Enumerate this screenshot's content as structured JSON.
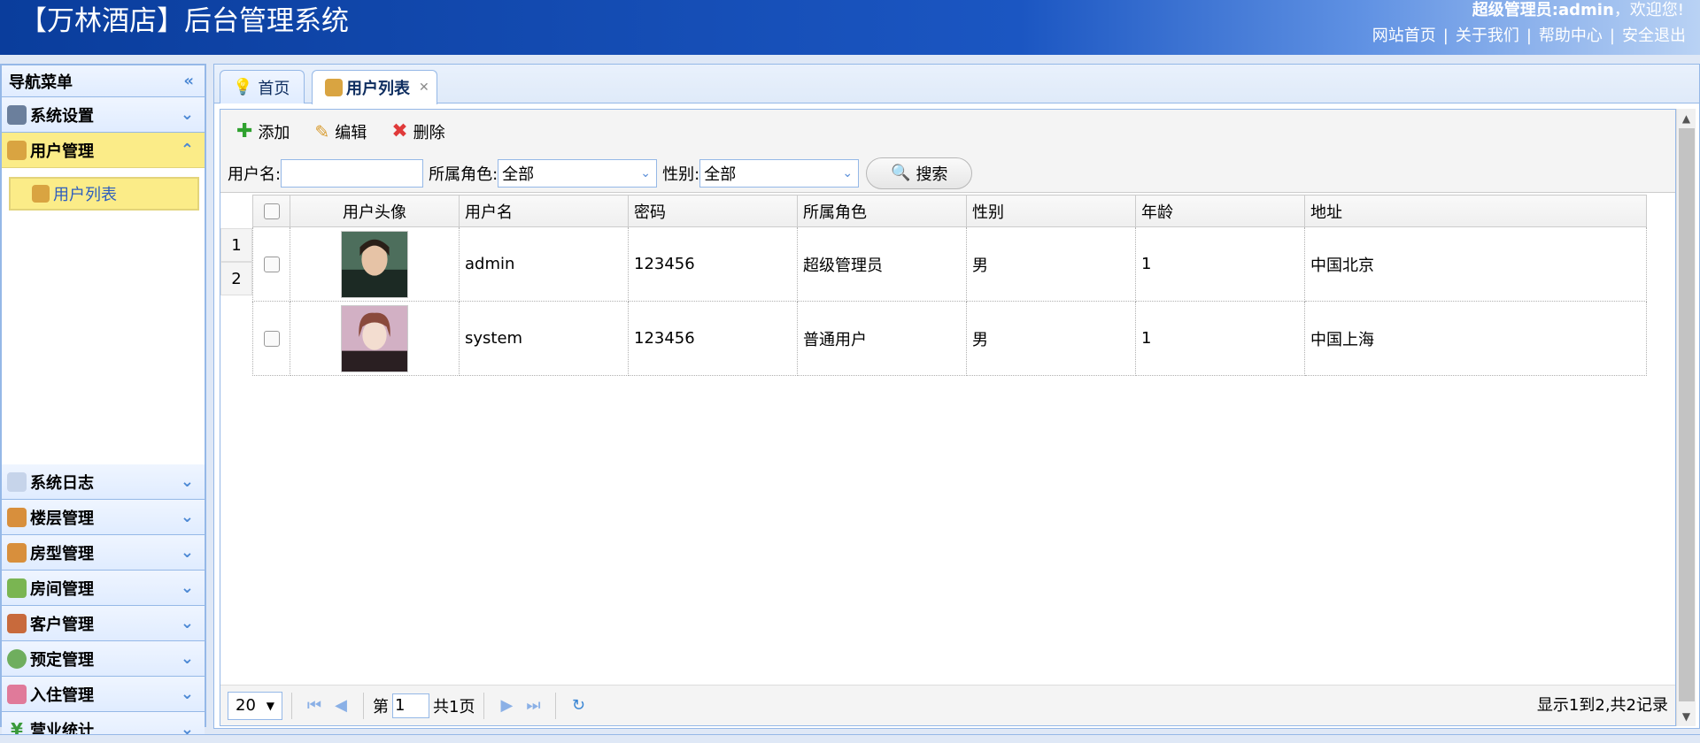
{
  "header": {
    "title": "【万林酒店】后台管理系统",
    "welcome_user": "超级管理员:admin",
    "welcome_suffix": "，欢迎您!",
    "links": [
      "网站首页",
      "关于我们",
      "帮助中心",
      "安全退出"
    ]
  },
  "nav": {
    "title": "导航菜单",
    "groups": [
      {
        "label": "系统设置"
      },
      {
        "label": "用户管理"
      },
      {
        "label": "系统日志"
      },
      {
        "label": "楼层管理"
      },
      {
        "label": "房型管理"
      },
      {
        "label": "房间管理"
      },
      {
        "label": "客户管理"
      },
      {
        "label": "预定管理"
      },
      {
        "label": "入住管理"
      },
      {
        "label": "营业统计"
      }
    ],
    "sub_item": "用户列表"
  },
  "tabs": [
    {
      "label": "首页"
    },
    {
      "label": "用户列表"
    }
  ],
  "toolbar": {
    "add": "添加",
    "edit": "编辑",
    "delete": "删除"
  },
  "filters": {
    "username_label": "用户名:",
    "username_value": "",
    "role_label": "所属角色:",
    "role_value": "全部",
    "gender_label": "性别:",
    "gender_value": "全部",
    "search": "搜索"
  },
  "table": {
    "headers": [
      "用户头像",
      "用户名",
      "密码",
      "所属角色",
      "性别",
      "年龄",
      "地址"
    ],
    "row_numbers": [
      "1",
      "2"
    ],
    "rows": [
      [
        "admin",
        "123456",
        "超级管理员",
        "男",
        "1",
        "中国北京"
      ],
      [
        "system",
        "123456",
        "普通用户",
        "男",
        "1",
        "中国上海"
      ]
    ]
  },
  "pager": {
    "page_size": "20",
    "page_prefix": "第",
    "page_value": "1",
    "page_suffix": "共1页",
    "info": "显示1到2,共2记录"
  },
  "colors": {
    "header_blue": "#0a3d9c",
    "highlight_yellow": "#fbec88",
    "border_blue": "#95b8e7"
  }
}
